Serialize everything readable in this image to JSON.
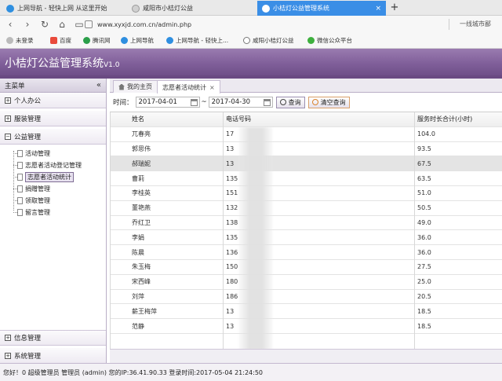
{
  "browser": {
    "tabs": [
      {
        "label": "上网导航 - 轻快上网 从这里开始",
        "active": false
      },
      {
        "label": "咸阳市小桔灯公益",
        "active": false
      },
      {
        "label": "小桔灯公益管理系统",
        "active": true
      }
    ],
    "new_tab": "+",
    "close": "×",
    "url": "www.xyxjd.com.cn/admin.php",
    "url_right": "一线城市鄙",
    "bookmarks": [
      "未登录",
      "百度",
      "腾讯网",
      "上网导航",
      "上网导航 - 轻快上...",
      "咸阳小桔灯公益",
      "微信公众平台"
    ]
  },
  "app": {
    "title": "小桔灯公益管理系统",
    "version": "V1.0",
    "sidebar": {
      "header": "主菜单",
      "collapse": "«",
      "sections": [
        {
          "label": "个人办公",
          "expanded": false
        },
        {
          "label": "服装管理",
          "expanded": false
        },
        {
          "label": "公益管理",
          "expanded": true
        }
      ],
      "sub_items": [
        {
          "label": "活动管理",
          "selected": false
        },
        {
          "label": "志愿者活动登记管理",
          "selected": false
        },
        {
          "label": "志愿者活动统计",
          "selected": true
        },
        {
          "label": "捐赠管理",
          "selected": false
        },
        {
          "label": "领取管理",
          "selected": false
        },
        {
          "label": "留言管理",
          "selected": false
        }
      ],
      "bottom_sections": [
        {
          "label": "信息管理"
        },
        {
          "label": "系统管理"
        }
      ]
    },
    "page_tabs": [
      {
        "label": "我的主页",
        "active": false
      },
      {
        "label": "志愿者活动统计",
        "active": true
      }
    ],
    "filter": {
      "label": "时间：",
      "date_from": "2017-04-01",
      "separator": "~",
      "date_to": "2017-04-30",
      "search_label": "查询",
      "clear_label": "清空查询"
    },
    "table": {
      "columns": [
        "姓名",
        "电话号码",
        "服务时长合计(小时)"
      ],
      "rows": [
        {
          "name": "兀春亮",
          "phone": "17",
          "hours": "104.0"
        },
        {
          "name": "郭思伟",
          "phone": "13",
          "hours": "93.5"
        },
        {
          "name": "郝瑞妮",
          "phone": "13",
          "hours": "67.5"
        },
        {
          "name": "曹莉",
          "phone": "135",
          "hours": "63.5"
        },
        {
          "name": "李桂英",
          "phone": "151",
          "hours": "51.0"
        },
        {
          "name": "董艳燕",
          "phone": "132",
          "hours": "50.5"
        },
        {
          "name": "乔红卫",
          "phone": "138",
          "hours": "49.0"
        },
        {
          "name": "李娟",
          "phone": "135",
          "hours": "36.0"
        },
        {
          "name": "陈晨",
          "phone": "136",
          "hours": "36.0"
        },
        {
          "name": "朱玉梅",
          "phone": "150",
          "hours": "27.5"
        },
        {
          "name": "宋西峰",
          "phone": "180",
          "hours": "25.0"
        },
        {
          "name": "刘萍",
          "phone": "186",
          "hours": "20.5"
        },
        {
          "name": "薪王梅萍",
          "phone": "13",
          "hours": "18.5"
        },
        {
          "name": "范静",
          "phone": "13",
          "hours": "18.5"
        }
      ]
    },
    "status_bar": "您好！0  超级管理员 管理员 (admin) 您的IP:36.41.90.33 登录时间:2017-05-04 21:24:50"
  },
  "colors": {
    "header_purple": "#7e5d98",
    "active_tab_blue": "#3a8ee6"
  }
}
